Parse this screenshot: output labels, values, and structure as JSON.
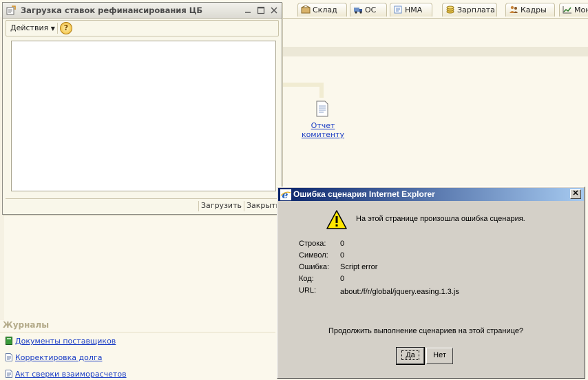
{
  "background": {
    "tabs": [
      {
        "label": "Склад",
        "icon": "warehouse-icon"
      },
      {
        "label": "ОС",
        "icon": "truck-icon"
      },
      {
        "label": "НМА",
        "icon": "nma-icon"
      },
      {
        "label": "Зарплата",
        "icon": "coins-icon"
      },
      {
        "label": "Кадры",
        "icon": "people-icon"
      },
      {
        "label": "Мон",
        "icon": "chart-icon"
      }
    ],
    "report_link": "Отчет комитенту",
    "journals": {
      "title": "Журналы",
      "items": [
        {
          "label": "Документы поставщиков",
          "icon": "book-icon"
        },
        {
          "label": "Корректировка долга",
          "icon": "document-icon"
        },
        {
          "label": "Акт сверки взаиморасчетов",
          "icon": "document-icon"
        }
      ]
    }
  },
  "form": {
    "title": "Загрузка ставок рефинансирования ЦБ",
    "actions_label": "Действия",
    "help_label": "?",
    "load_label": "Загрузить",
    "close_label": "Закрыть"
  },
  "dialog": {
    "title": "Ошибка сценария Internet Explorer",
    "close_label": "✕",
    "message": "На этой странице произошла ошибка сценария.",
    "fields": [
      {
        "label": "Строка:",
        "value": "0"
      },
      {
        "label": "Символ:",
        "value": "0"
      },
      {
        "label": "Ошибка:",
        "value": "Script error"
      },
      {
        "label": "Код:",
        "value": "0"
      },
      {
        "label": "URL:",
        "value": "about:/f/r/global/jquery.easing.1.3.js"
      }
    ],
    "question": "Продолжить выполнение сценариев на этой странице?",
    "yes_label": "Да",
    "no_label": "Нет"
  }
}
